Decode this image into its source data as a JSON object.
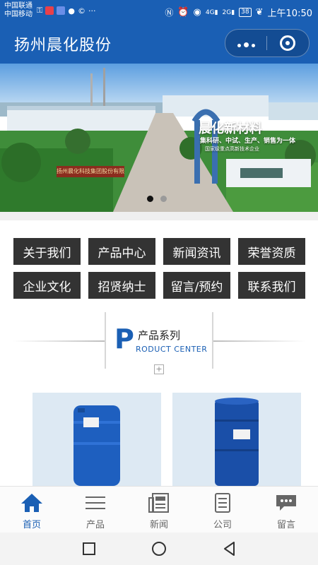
{
  "status_bar": {
    "carrier_1": "中国联通",
    "carrier_2": "中国移动",
    "time": "上午10:50",
    "battery": "38",
    "signal_1": "4G",
    "signal_2": "2G",
    "more": "···"
  },
  "header": {
    "title": "扬州晨化股份"
  },
  "banner": {
    "headline": "晨化新材料",
    "subline": "集科研、中试、生产、销售为一体",
    "subline2": "国家级重点高新技术企业",
    "sign": "扬州晨化科技集团股份有限公司",
    "slide_count": 2,
    "active_slide": 1
  },
  "menu": {
    "items": [
      "关于我们",
      "产品中心",
      "新闻资讯",
      "荣誉资质",
      "企业文化",
      "招贤纳士",
      "留言/预约",
      "联系我们"
    ]
  },
  "section": {
    "letter": "P",
    "title": "产品系列",
    "subtitle": "RODUCT CENTER"
  },
  "tabbar": {
    "items": [
      {
        "label": "首页",
        "icon": "home-icon",
        "active": true
      },
      {
        "label": "产品",
        "icon": "menu-lines-icon",
        "active": false
      },
      {
        "label": "新闻",
        "icon": "newspaper-icon",
        "active": false
      },
      {
        "label": "公司",
        "icon": "document-icon",
        "active": false
      },
      {
        "label": "留言",
        "icon": "chat-bubble-icon",
        "active": false
      }
    ]
  },
  "colors": {
    "brand_blue": "#1a5fb4",
    "menu_bg": "#333333",
    "tab_active": "#1a5fb4",
    "tab_inactive": "#666666"
  }
}
